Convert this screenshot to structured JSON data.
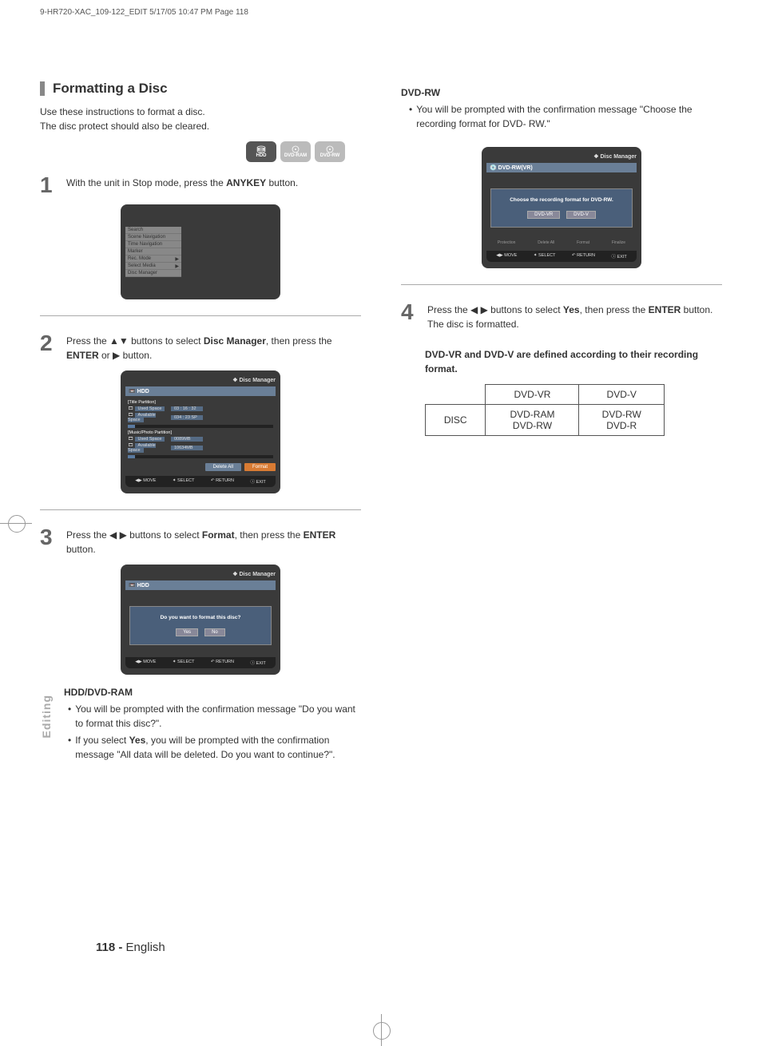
{
  "header": "9-HR720-XAC_109-122_EDIT  5/17/05  10:47 PM  Page 118",
  "section_title": "Formatting a Disc",
  "intro_line1": "Use these instructions to format a disc.",
  "intro_line2": "The disc protect should also be cleared.",
  "disc_labels": {
    "hdd": "HDD",
    "ram": "DVD-RAM",
    "rw": "DVD-RW"
  },
  "step1": {
    "num": "1",
    "pre": "With the unit in Stop mode, press the ",
    "bold": "ANYKEY",
    "post": " button."
  },
  "menu1": [
    "Search",
    "Scene Navigation",
    "Time Navigation",
    "Marker",
    "Rec. Mode",
    "Select Media",
    "Disc Manager"
  ],
  "menu1_arrows": [
    4,
    5
  ],
  "step2": {
    "num": "2",
    "t1": "Press the ",
    "t2": " buttons to select ",
    "b1": "Disc Manager",
    "t3": ", then press the ",
    "b2": "ENTER",
    "t4": " or ",
    "t5": " button."
  },
  "screen2": {
    "title": "Disc Manager",
    "hdd": "HDD",
    "title_partition": "[Title Partition]",
    "used1": "Used Space",
    "used1v": "03 : 16 : 32",
    "avail1": "Available Space",
    "avail1v": "034 : 23 SP",
    "music_partition": "[Music/Photo Partition]",
    "used2": "Used Space",
    "used2v": "0089MB",
    "avail2": "Available Space",
    "avail2v": "10634MB",
    "btn_delete": "Delete All",
    "btn_format": "Format"
  },
  "footer_bar": {
    "move": "MOVE",
    "select": "SELECT",
    "return": "RETURN",
    "exit": "EXIT"
  },
  "step3": {
    "num": "3",
    "t1": "Press the ",
    "t2": " buttons to select ",
    "b1": "Format",
    "t3": ", then press the ",
    "b2": "ENTER",
    "t4": " button."
  },
  "screen3": {
    "title": "Disc Manager",
    "hdd": "HDD",
    "q": "Do you want to format this disc?",
    "yes": "Yes",
    "no": "No"
  },
  "sub_hdd": "HDD/DVD-RAM",
  "hdd_bullets": [
    "You will be prompted with the confirmation message \"Do you want to format this disc?\".",
    "If you select Yes, you will be prompted with the confirmation message \"All data will be deleted. Do you want to continue?\"."
  ],
  "hdd_bullet2_boldword": "Yes",
  "sub_rw": "DVD-RW",
  "rw_bullet": "You will be prompted with the confirmation message \"Choose the recording format for DVD- RW.\"",
  "screen_rw": {
    "title": "Disc Manager",
    "label": "DVD-RW(VR)",
    "q": "Choose the recording format for DVD-RW.",
    "vr": "DVD-VR",
    "v": "DVD-V"
  },
  "screen_rw_footer_row": [
    "Protection",
    "Delete All",
    "Format",
    "Finalize"
  ],
  "step4": {
    "num": "4",
    "t1": "Press the ",
    "t2": " buttons to select ",
    "b1": "Yes",
    "t3": ", then press the ",
    "b2": "ENTER",
    "t4": " button. The disc is formatted."
  },
  "note": "DVD-VR and DVD-V are defined according to their recording format.",
  "table": {
    "h1": "DVD-VR",
    "h2": "DVD-V",
    "r1": "DISC",
    "c1a": "DVD-RAM",
    "c1b": "DVD-RW",
    "c2a": "DVD-RW",
    "c2b": "DVD-R"
  },
  "side_tab": "Editing",
  "page_num": "118 -",
  "page_lang": "English"
}
